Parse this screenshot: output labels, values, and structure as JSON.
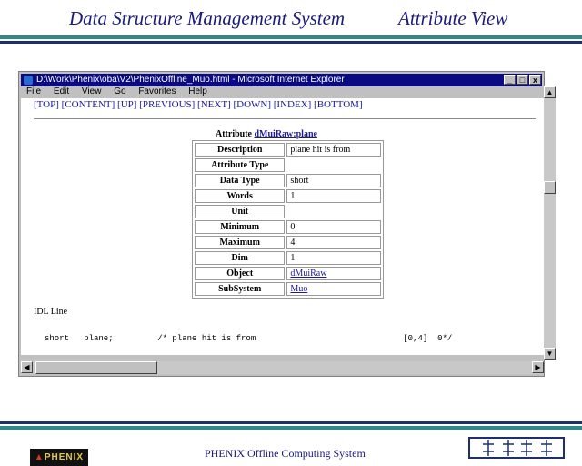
{
  "slide": {
    "title": "Data Structure Management System",
    "subtitle": "Attribute View",
    "footer": "PHENIX Offline Computing System",
    "logo_text": "PHENIX"
  },
  "window": {
    "title": "D:\\Work\\Phenix\\oba\\V2\\PhenixOffline_Muo.html - Microsoft Internet Explorer",
    "buttons": {
      "minimize": "_",
      "maximize": "□",
      "close": "x"
    },
    "menu": [
      "File",
      "Edit",
      "View",
      "Go",
      "Favorites",
      "Help"
    ]
  },
  "page": {
    "nav_links": "[TOP] [CONTENT] [UP] [PREVIOUS] [NEXT] [DOWN] [INDEX] [BOTTOM]",
    "caption_prefix": "Attribute ",
    "caption_link": "dMuiRaw:plane",
    "attributes": [
      {
        "key": "Description",
        "value": "plane hit is from"
      },
      {
        "key": "Attribute Type",
        "value": ""
      },
      {
        "key": "Data Type",
        "value": "short"
      },
      {
        "key": "Words",
        "value": "1"
      },
      {
        "key": "Unit",
        "value": ""
      },
      {
        "key": "Minimum",
        "value": "0"
      },
      {
        "key": "Maximum",
        "value": "4"
      },
      {
        "key": "Dim",
        "value": "1"
      },
      {
        "key": "Object",
        "value": "dMuiRaw"
      },
      {
        "key": "SubSystem",
        "value": "Muo"
      }
    ],
    "idl_label": "IDL Line",
    "idl_text": "short   plane;         /* plane hit is from                              [0,4]  0*/"
  },
  "colors": {
    "title": "#1a1a80",
    "bar_dark": "#1e2f6e",
    "bar_teal": "#2e8a8a",
    "titlebar": "#0a0a82",
    "link": "#1a1aa0"
  }
}
